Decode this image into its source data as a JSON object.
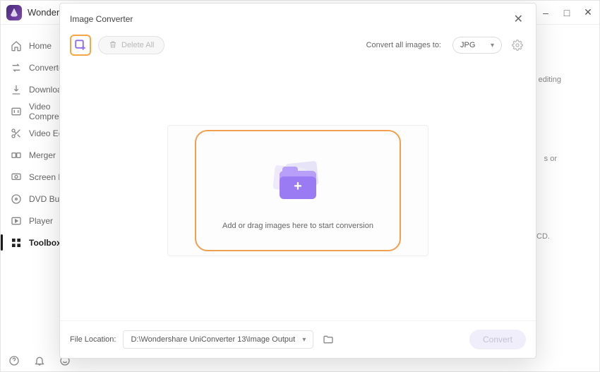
{
  "app": {
    "title": "Wondershare UniConverter"
  },
  "window_controls": {
    "min": "–",
    "max": "□",
    "close": "✕"
  },
  "sidebar": {
    "items": [
      {
        "label": "Home"
      },
      {
        "label": "Converter"
      },
      {
        "label": "Downloader"
      },
      {
        "label": "Video Compressor"
      },
      {
        "label": "Video Editor"
      },
      {
        "label": "Merger"
      },
      {
        "label": "Screen Recorder"
      },
      {
        "label": "DVD Burner"
      },
      {
        "label": "Player"
      },
      {
        "label": "Toolbox"
      }
    ]
  },
  "dialog": {
    "title": "Image Converter",
    "delete_all": "Delete All",
    "convert_all_label": "Convert all images to:",
    "format": "JPG",
    "drop_text": "Add or drag images here to start conversion",
    "file_location_label": "File Location:",
    "file_location_value": "D:\\Wondershare UniConverter 13\\Image Output",
    "convert": "Convert"
  }
}
